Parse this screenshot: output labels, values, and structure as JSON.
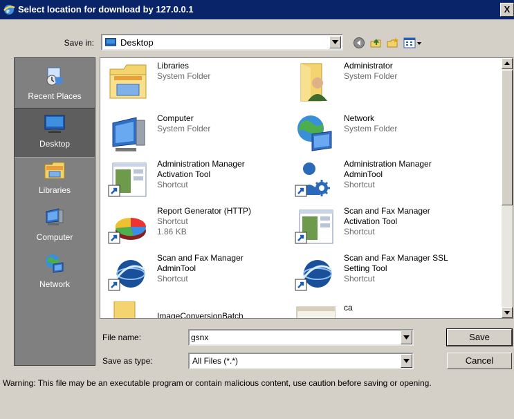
{
  "window": {
    "title": "Select location for download by 127.0.0.1",
    "close_label": "X"
  },
  "toolbar": {
    "save_in_label": "Save in:",
    "save_in_value": "Desktop",
    "buttons": [
      "back-icon",
      "up-folder-icon",
      "new-folder-icon",
      "views-menu-icon"
    ]
  },
  "places": [
    {
      "label": "Recent Places",
      "icon": "recent-places-icon"
    },
    {
      "label": "Desktop",
      "icon": "desktop-icon",
      "selected": true
    },
    {
      "label": "Libraries",
      "icon": "libraries-icon"
    },
    {
      "label": "Computer",
      "icon": "computer-icon"
    },
    {
      "label": "Network",
      "icon": "network-icon"
    }
  ],
  "files": [
    {
      "name": "Libraries",
      "lines": [
        "System Folder"
      ],
      "icon": "libraries-folder-icon"
    },
    {
      "name": "Administrator",
      "lines": [
        "System Folder"
      ],
      "icon": "user-folder-icon"
    },
    {
      "name": "Computer",
      "lines": [
        "System Folder"
      ],
      "icon": "computer-icon"
    },
    {
      "name": "Network",
      "lines": [
        "System Folder"
      ],
      "icon": "network-icon"
    },
    {
      "name": "Administration Manager Activation Tool",
      "name_lines": [
        "Administration Manager",
        "Activation Tool"
      ],
      "lines": [
        "Shortcut"
      ],
      "icon": "window-shortcut-icon"
    },
    {
      "name": "Administration Manager AdminTool",
      "name_lines": [
        "Administration Manager",
        "AdminTool"
      ],
      "lines": [
        "Shortcut"
      ],
      "icon": "admin-gear-shortcut-icon"
    },
    {
      "name": "Report Generator (HTTP)",
      "name_lines": [
        "Report Generator (HTTP)"
      ],
      "lines": [
        "Shortcut",
        "1.86 KB"
      ],
      "icon": "pie-chart-shortcut-icon"
    },
    {
      "name": "Scan and Fax Manager Activation Tool",
      "name_lines": [
        "Scan and Fax Manager",
        "Activation Tool"
      ],
      "lines": [
        "Shortcut"
      ],
      "icon": "window-shortcut-icon"
    },
    {
      "name": "Scan and Fax Manager AdminTool",
      "name_lines": [
        "Scan and Fax Manager",
        "AdminTool"
      ],
      "lines": [
        "Shortcut"
      ],
      "icon": "globe-shortcut-icon"
    },
    {
      "name": "Scan and Fax Manager SSL Setting Tool",
      "name_lines": [
        "Scan and Fax Manager SSL",
        "Setting Tool"
      ],
      "lines": [
        "Shortcut"
      ],
      "icon": "globe-shortcut-icon"
    },
    {
      "name": "ImageConversionBatch",
      "lines": [],
      "icon": "folder-icon"
    },
    {
      "name": "ca",
      "lines": [],
      "icon": "certificate-icon"
    }
  ],
  "form": {
    "file_name_label": "File name:",
    "file_name_value": "gsnx",
    "save_as_type_label": "Save as type:",
    "save_as_type_value": "All Files (*.*)",
    "save_button": "Save",
    "cancel_button": "Cancel"
  },
  "warning": "Warning: This file may be an executable program or contain malicious content, use caution before saving or opening.",
  "colors": {
    "title_bar": "#0a246a",
    "places_bar": "#808080",
    "dialog_bg": "#d4d0c8",
    "subtext": "#6d6d6d"
  }
}
